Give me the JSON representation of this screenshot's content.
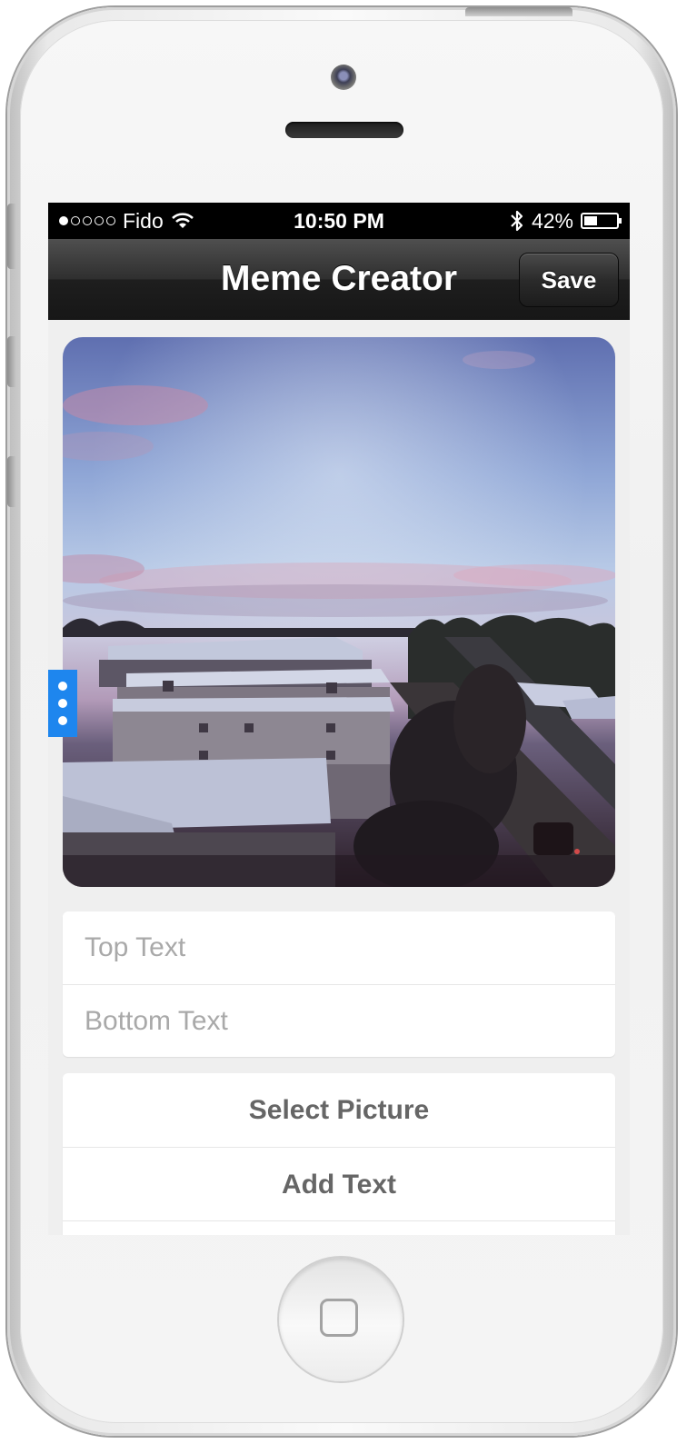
{
  "status_bar": {
    "carrier": "Fido",
    "time": "10:50 PM",
    "battery": "42%",
    "battery_level": 0.42,
    "signal_bars": 1
  },
  "nav": {
    "title": "Meme Creator",
    "save_label": "Save"
  },
  "form": {
    "top_text_placeholder": "Top Text",
    "bottom_text_placeholder": "Bottom Text",
    "top_text_value": "",
    "bottom_text_value": ""
  },
  "actions": {
    "select_picture": "Select Picture",
    "add_text": "Add Text"
  },
  "colors": {
    "accent": "#1e86ee",
    "nav_bar": "#2b2b2b",
    "background": "#efefef"
  }
}
